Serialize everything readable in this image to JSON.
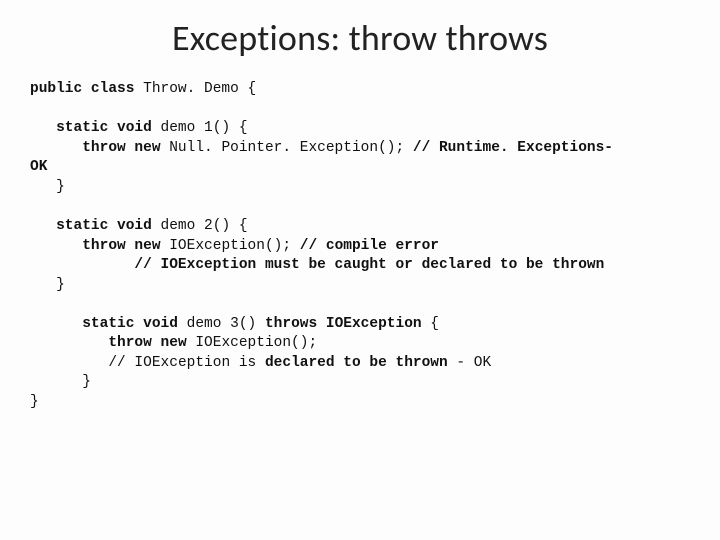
{
  "title": "Exceptions: throw throws",
  "code": {
    "l01a": "public class",
    "l01b": " Throw. Demo {",
    "l02": "",
    "l03a": "   static void ",
    "l03b": "demo 1",
    "l03c": "() {",
    "l04a": "      throw new ",
    "l04b": "Null. Pointer. Exception(); ",
    "l04c": "// Runtime. Exceptions-",
    "l05": "OK",
    "l06": "   }",
    "l07": "",
    "l08a": "   static void ",
    "l08b": "demo 2",
    "l08c": "() {",
    "l09a": "      throw new ",
    "l09b": "IOException(); ",
    "l09c": "// compile error",
    "l10": "            // IOException must be caught or declared to be thrown",
    "l11": "   }",
    "l12": "",
    "l13a": "      static void ",
    "l13b": "demo 3",
    "l13c": "() ",
    "l13d": "throws IOException",
    "l13e": " {",
    "l14a": "         throw new ",
    "l14b": "IOException();",
    "l15a": "         // IOException is ",
    "l15b": "declared to be thrown",
    "l15c": " - OK",
    "l16": "      }",
    "l17": "}"
  }
}
